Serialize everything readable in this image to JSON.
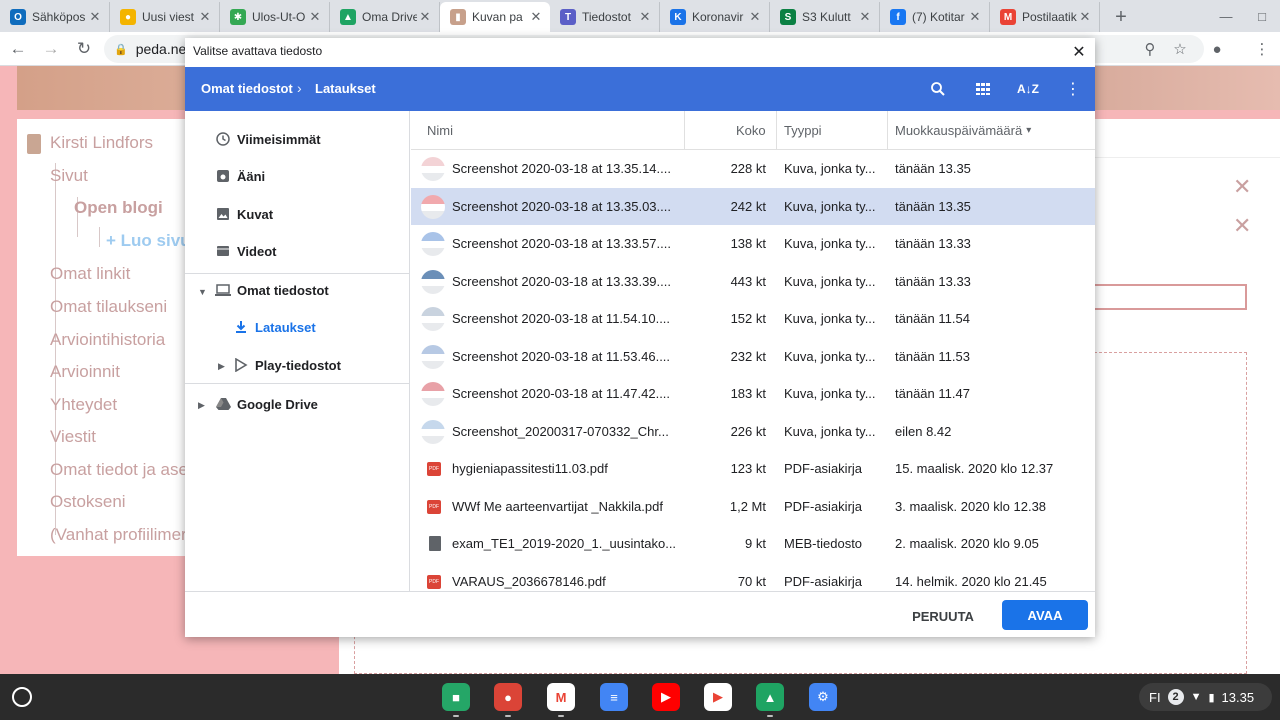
{
  "browser": {
    "tabs": [
      {
        "label": "Sähköpos",
        "favicon_color": "#0f6cbd",
        "favicon_char": "O"
      },
      {
        "label": "Uusi viest",
        "favicon_color": "#f4b400",
        "favicon_char": "●"
      },
      {
        "label": "Ulos-Ut-O",
        "favicon_color": "#34a853",
        "favicon_char": "✱"
      },
      {
        "label": "Oma Drive",
        "favicon_color": "#1fa463",
        "favicon_char": "▲"
      },
      {
        "label": "Kuvan pa",
        "favicon_color": "#c7a08b",
        "favicon_char": "▮"
      },
      {
        "label": "Tiedostot",
        "favicon_color": "#5b5fc7",
        "favicon_char": "T"
      },
      {
        "label": "Koronavir",
        "favicon_color": "#1a73e8",
        "favicon_char": "K"
      },
      {
        "label": "S3 Kulutt",
        "favicon_color": "#0b8043",
        "favicon_char": "S"
      },
      {
        "label": "(7) Kotitar",
        "favicon_color": "#1877f2",
        "favicon_char": "f"
      },
      {
        "label": "Postilaatik",
        "favicon_color": "#ea4335",
        "favicon_char": "M"
      }
    ],
    "active_tab": 4,
    "address": "peda.net",
    "icons": {
      "back": "back-arrow-icon",
      "forward": "forward-arrow-icon",
      "reload": "reload-icon",
      "lock": "lock-icon",
      "zoom": "zoom-icon",
      "star": "bookmark-star-icon",
      "profile": "profile-icon",
      "menu": "browser-menu-icon"
    }
  },
  "background_page": {
    "sidebar": {
      "user": "Kirsti Lindfors",
      "items": [
        "Sivut",
        "Open blogi",
        "+ Luo sivu",
        "Omat linkit",
        "Omat tilaukseni",
        "Arviointihistoria",
        "Arvioinnit",
        "Yhteydet",
        "Viestit",
        "Omat tiedot ja ase",
        "Ostokseni",
        "(Vanhat profiilimer"
      ]
    }
  },
  "dialog": {
    "title": "Valitse avattava tiedosto",
    "breadcrumb": [
      "Omat tiedostot",
      "Lataukset"
    ],
    "nav": {
      "recent": "Viimeisimmät",
      "audio": "Ääni",
      "images": "Kuvat",
      "videos": "Videot",
      "my_files": "Omat tiedostot",
      "downloads": "Lataukset",
      "play_files": "Play-tiedostot",
      "google_drive": "Google Drive"
    },
    "columns": {
      "name": "Nimi",
      "size": "Koko",
      "type": "Tyyppi",
      "modified": "Muokkauspäivämäärä"
    },
    "sort_indicator": "▾",
    "files": [
      {
        "name": "Screenshot 2020-03-18 at 13.35.14....",
        "size": "228 kt",
        "type": "Kuva, jonka ty...",
        "modified": "tänään 13.35",
        "kind": "image",
        "thumb": "#f3d3d6"
      },
      {
        "name": "Screenshot 2020-03-18 at 13.35.03....",
        "size": "242 kt",
        "type": "Kuva, jonka ty...",
        "modified": "tänään 13.35",
        "kind": "image",
        "thumb": "#f1a9ad"
      },
      {
        "name": "Screenshot 2020-03-18 at 13.33.57....",
        "size": "138 kt",
        "type": "Kuva, jonka ty...",
        "modified": "tänään 13.33",
        "kind": "image",
        "thumb": "#a9c3e8"
      },
      {
        "name": "Screenshot 2020-03-18 at 13.33.39....",
        "size": "443 kt",
        "type": "Kuva, jonka ty...",
        "modified": "tänään 13.33",
        "kind": "image",
        "thumb": "#6b8fb8"
      },
      {
        "name": "Screenshot 2020-03-18 at 11.54.10....",
        "size": "152 kt",
        "type": "Kuva, jonka ty...",
        "modified": "tänään 11.54",
        "kind": "image",
        "thumb": "#c9d3df"
      },
      {
        "name": "Screenshot 2020-03-18 at 11.53.46....",
        "size": "232 kt",
        "type": "Kuva, jonka ty...",
        "modified": "tänään 11.53",
        "kind": "image",
        "thumb": "#b7c9e4"
      },
      {
        "name": "Screenshot 2020-03-18 at 11.47.42....",
        "size": "183 kt",
        "type": "Kuva, jonka ty...",
        "modified": "tänään 11.47",
        "kind": "image",
        "thumb": "#e8a1a7"
      },
      {
        "name": "Screenshot_20200317-070332_Chr...",
        "size": "226 kt",
        "type": "Kuva, jonka ty...",
        "modified": "eilen 8.42",
        "kind": "image",
        "thumb": "#c6d8ec"
      },
      {
        "name": "hygieniapassitesti11.03.pdf",
        "size": "123 kt",
        "type": "PDF-asiakirja",
        "modified": "15. maalisk. 2020 klo 12.37",
        "kind": "pdf"
      },
      {
        "name": "WWf Me aarteenvartijat _Nakkila.pdf",
        "size": "1,2 Mt",
        "type": "PDF-asiakirja",
        "modified": "3. maalisk. 2020 klo 12.38",
        "kind": "pdf"
      },
      {
        "name": "exam_TE1_2019-2020_1._uusintako...",
        "size": "9 kt",
        "type": "MEB-tiedosto",
        "modified": "2. maalisk. 2020 klo 9.05",
        "kind": "doc"
      },
      {
        "name": "VARAUS_2036678146.pdf",
        "size": "70 kt",
        "type": "PDF-asiakirja",
        "modified": "14. helmik. 2020 klo 21.45",
        "kind": "pdf"
      }
    ],
    "selected_index": 1,
    "cancel_label": "PERUUTA",
    "open_label": "AVAA"
  },
  "shelf": {
    "apps": [
      {
        "name": "classroom-icon",
        "color": "#25a667"
      },
      {
        "name": "chrome-icon",
        "color": "#db4437"
      },
      {
        "name": "gmail-icon",
        "color": "#ffffff"
      },
      {
        "name": "docs-icon",
        "color": "#4285f4"
      },
      {
        "name": "youtube-icon",
        "color": "#ff0000"
      },
      {
        "name": "play-store-icon",
        "color": "#ffffff"
      },
      {
        "name": "drive-icon",
        "color": "#1fa463"
      },
      {
        "name": "settings-icon",
        "color": "#4285f4"
      }
    ],
    "tray": {
      "lang": "FI",
      "notifications": "2",
      "time": "13.35"
    }
  },
  "colors": {
    "accent": "#1a73e8",
    "dialog_bar": "#3b6fd9",
    "selected_row": "#d2dcf1",
    "page_bg": "#f6b6b8"
  }
}
